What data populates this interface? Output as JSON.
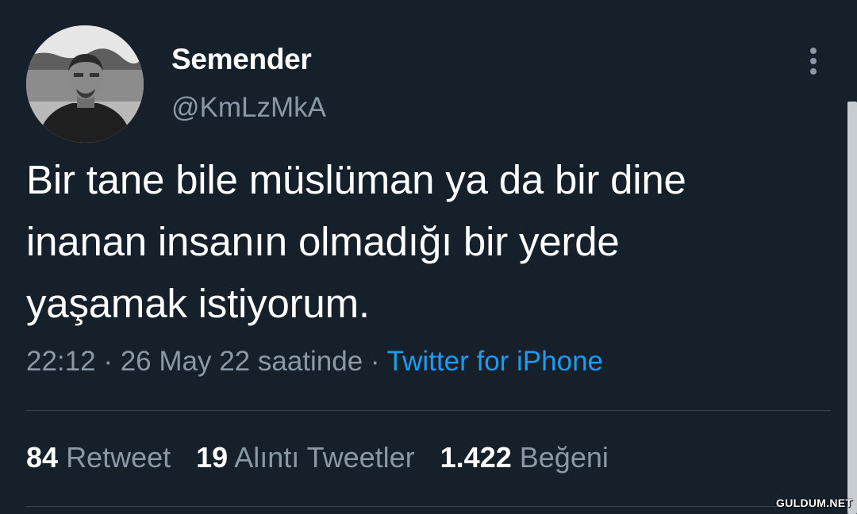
{
  "author": {
    "display_name": "Semender",
    "handle": "@KmLzMkA",
    "avatar_icon": "profile-photo"
  },
  "more_icon": "more-options-vertical-icon",
  "tweet": {
    "text": "Bir tane bile müslüman ya da bir dine\ninanan insanın olmadığı bir yerde\nyaşamak istiyorum."
  },
  "meta": {
    "time": "22:12",
    "separator": " · ",
    "date": "26 May 22 saatinde",
    "source": "Twitter for iPhone"
  },
  "stats": {
    "retweets": {
      "count": "84",
      "label": "Retweet"
    },
    "quotes": {
      "count": "19",
      "label": "Alıntı Tweetler"
    },
    "likes": {
      "count": "1.422",
      "label": "Beğeni"
    }
  },
  "watermark": "GULDUM.NET",
  "colors": {
    "background": "#15202b",
    "primary_text": "#ffffff",
    "secondary_text": "#8b98a5",
    "link": "#1d9bf0",
    "divider": "#38444d"
  }
}
